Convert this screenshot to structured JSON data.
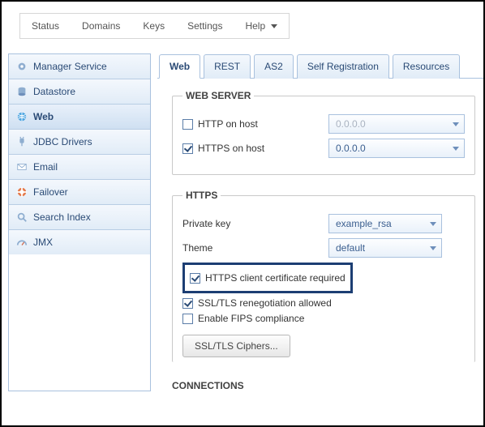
{
  "topnav": {
    "status": "Status",
    "domains": "Domains",
    "keys": "Keys",
    "settings": "Settings",
    "help": "Help"
  },
  "sidebar": {
    "items": [
      {
        "label": "Manager Service",
        "icon": "gear"
      },
      {
        "label": "Datastore",
        "icon": "db"
      },
      {
        "label": "Web",
        "icon": "globe"
      },
      {
        "label": "JDBC Drivers",
        "icon": "plug"
      },
      {
        "label": "Email",
        "icon": "mail"
      },
      {
        "label": "Failover",
        "icon": "life"
      },
      {
        "label": "Search Index",
        "icon": "search"
      },
      {
        "label": "JMX",
        "icon": "gauge"
      }
    ]
  },
  "tabs": {
    "web": "Web",
    "rest": "REST",
    "as2": "AS2",
    "self_reg": "Self Registration",
    "resources": "Resources"
  },
  "webserver": {
    "legend": "WEB SERVER",
    "http_label": "HTTP on host",
    "https_label": "HTTPS on host",
    "http_host_placeholder": "0.0.0.0",
    "https_host_value": "0.0.0.0",
    "http_checked": false,
    "https_checked": true
  },
  "https": {
    "legend": "HTTPS",
    "private_key_label": "Private key",
    "private_key_value": "example_rsa",
    "theme_label": "Theme",
    "theme_value": "default",
    "client_cert_label": "HTTPS client certificate required",
    "client_cert_checked": true,
    "reneg_label": "SSL/TLS renegotiation allowed",
    "reneg_checked": true,
    "fips_label": "Enable FIPS compliance",
    "fips_checked": false,
    "ciphers_btn": "SSL/TLS Ciphers..."
  },
  "connections": {
    "legend": "CONNECTIONS"
  }
}
